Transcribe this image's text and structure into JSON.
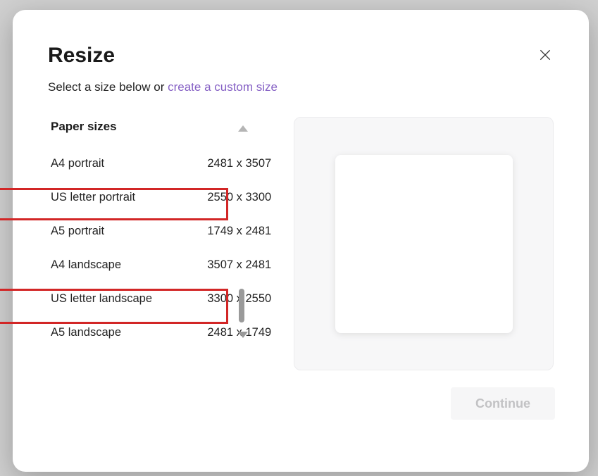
{
  "modal": {
    "title": "Resize",
    "subtitle_prefix": "Select a size below or ",
    "subtitle_link": "create a custom size"
  },
  "category": {
    "label": "Paper sizes"
  },
  "sizes": [
    {
      "name": "A4 portrait",
      "dims": "2481 x 3507"
    },
    {
      "name": "US letter portrait",
      "dims": "2550 x 3300"
    },
    {
      "name": "A5 portrait",
      "dims": "1749 x 2481"
    },
    {
      "name": "A4 landscape",
      "dims": "3507 x 2481"
    },
    {
      "name": "US letter landscape",
      "dims": "3300 x 2550"
    },
    {
      "name": "A5 landscape",
      "dims": "2481 x 1749"
    }
  ],
  "buttons": {
    "continue": "Continue"
  }
}
